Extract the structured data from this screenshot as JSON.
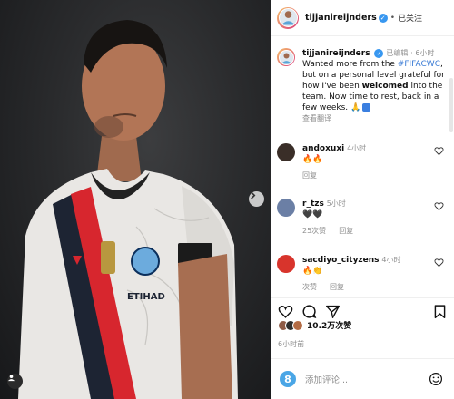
{
  "post": {
    "username": "tijjanireijnders",
    "follow_label": "已关注",
    "dot": "•"
  },
  "caption": {
    "username": "tijjanireijnders",
    "edited_label": "已编辑",
    "age": "6小时",
    "text_before_tag": "Wanted more from the ",
    "hashtag": "#FIFACWC",
    "text_mid": ", but on a personal level grateful for how I've been ",
    "bold_word": "welcomed",
    "text_after": " into the team. Now time to rest, back in a few weeks.",
    "see_translation": "查看翻译"
  },
  "comments": [
    {
      "username": "andoxuxi",
      "age": "4小时",
      "text": "🔥🔥",
      "reply_label": "回复",
      "likes_label": ""
    },
    {
      "username": "r_tzs",
      "age": "5小时",
      "text": "🖤🖤",
      "likes_label": "25次赞",
      "reply_label": "回复"
    },
    {
      "username": "sacdiyo_cityzens",
      "age": "4小时",
      "text": "🔥👏",
      "likes_label": "次赞",
      "reply_label": "回复"
    }
  ],
  "likes": {
    "count_label": "10.2万次赞"
  },
  "timestamp": "6小时前",
  "add_comment": {
    "placeholder": "添加评论...",
    "me_initial": "8"
  },
  "icons": {
    "verified": "verified-badge-icon",
    "like": "heart-icon",
    "comment": "comment-icon",
    "share": "share-icon",
    "save": "bookmark-icon",
    "next": "chevron-right-icon",
    "tag": "user-tag-icon",
    "emoji": "emoji-icon"
  },
  "colors": {
    "accent": "#3897f0",
    "hashtag": "#3a7bd5",
    "muted": "#8e8e8e"
  }
}
